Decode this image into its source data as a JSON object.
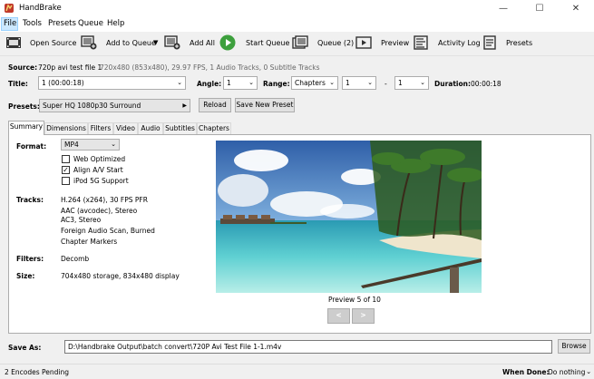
{
  "window": {
    "title": "HandBrake",
    "min_glyph": "—",
    "max_glyph": "☐",
    "close_glyph": "✕"
  },
  "menu": {
    "file": "File",
    "tools": "Tools",
    "presets": "Presets",
    "queue": "Queue",
    "help": "Help"
  },
  "toolbar": {
    "open_source": "Open Source",
    "add_to_queue": "Add to Queue",
    "add_all": "Add All",
    "start_queue": "Start Queue",
    "queue": "Queue (2)",
    "preview": "Preview",
    "activity_log": "Activity Log",
    "presets": "Presets"
  },
  "source": {
    "label": "Source:",
    "name": "720p avi test file 1",
    "details": "720x480 (853x480), 29.97 FPS, 1 Audio Tracks, 0 Subtitle Tracks"
  },
  "title_row": {
    "title_label": "Title:",
    "title_value": "1 (00:00:18)",
    "angle_label": "Angle:",
    "angle_value": "1",
    "range_label": "Range:",
    "range_type": "Chapters",
    "range_start": "1",
    "range_sep": "-",
    "range_end": "1",
    "duration_label": "Duration:",
    "duration_value": "00:00:18"
  },
  "presets_row": {
    "label": "Presets:",
    "value": "Super HQ 1080p30 Surround",
    "reload": "Reload",
    "save_new": "Save New Preset"
  },
  "tabs": [
    "Summary",
    "Dimensions",
    "Filters",
    "Video",
    "Audio",
    "Subtitles",
    "Chapters"
  ],
  "summary": {
    "format_label": "Format:",
    "format_value": "MP4",
    "web_optimized": "Web Optimized",
    "web_optimized_checked": false,
    "align_av": "Align A/V Start",
    "align_av_checked": true,
    "ipod": "iPod 5G Support",
    "ipod_checked": false,
    "tracks_label": "Tracks:",
    "tracks_video": "H.264 (x264), 30 FPS PFR",
    "tracks_audio1": "AAC (avcodec), Stereo",
    "tracks_audio2": "AC3, Stereo",
    "tracks_subs": "Foreign Audio Scan, Burned",
    "tracks_chapters": "Chapter Markers",
    "filters_label": "Filters:",
    "filters_value": "Decomb",
    "size_label": "Size:",
    "size_value": "704x480 storage, 834x480 display"
  },
  "preview": {
    "caption": "Preview 5 of 10",
    "prev": "<",
    "next": ">"
  },
  "save_as": {
    "label": "Save As:",
    "path": "D:\\Handbrake Output\\batch convert\\720P Avi Test File 1-1.m4v",
    "browse": "Browse"
  },
  "status": {
    "pending": "2 Encodes Pending",
    "when_done_label": "When Done:",
    "when_done_value": "Do nothing"
  },
  "colors": {
    "accent_green": "#3da03d",
    "menu_highlight": "#cce8ff"
  }
}
